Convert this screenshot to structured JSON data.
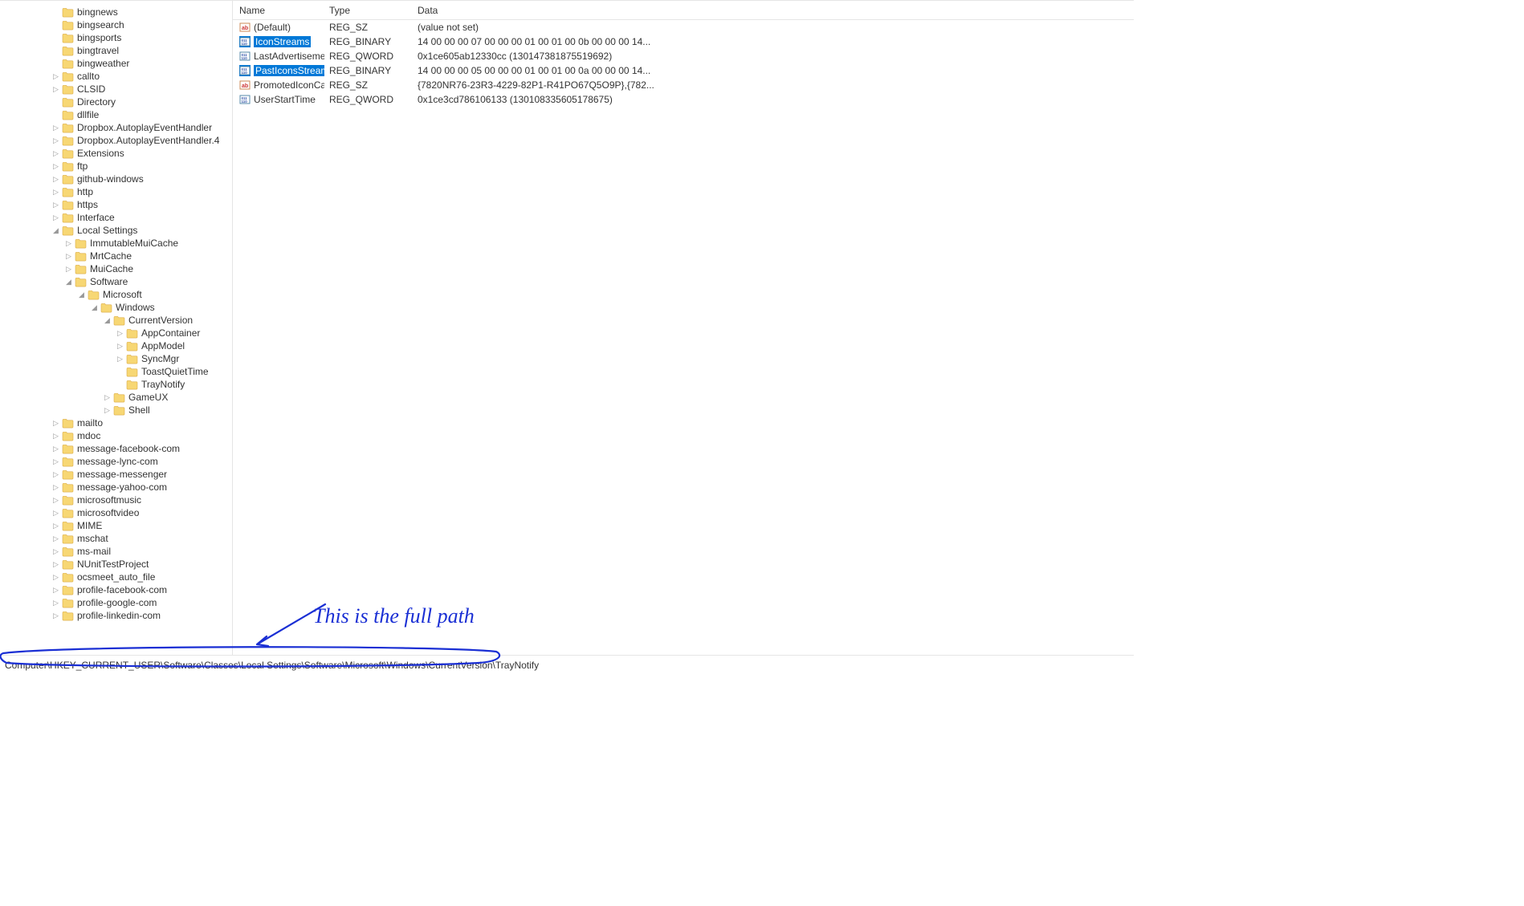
{
  "columns": {
    "name": "Name",
    "type": "Type",
    "data": "Data"
  },
  "rows": [
    {
      "icon": "sz",
      "name": "(Default)",
      "type": "REG_SZ",
      "data": "(value not set)",
      "selected": false
    },
    {
      "icon": "bin",
      "name": "IconStreams",
      "type": "REG_BINARY",
      "data": "14 00 00 00 07 00 00 00 01 00 01 00 0b 00 00 00 14...",
      "selected": true
    },
    {
      "icon": "bin",
      "name": "LastAdvertisement",
      "type": "REG_QWORD",
      "data": "0x1ce605ab12330cc (130147381875519692)",
      "selected": false
    },
    {
      "icon": "bin",
      "name": "PastIconsStream",
      "type": "REG_BINARY",
      "data": "14 00 00 00 05 00 00 00 01 00 01 00 0a 00 00 00 14...",
      "selected": true
    },
    {
      "icon": "sz",
      "name": "PromotedIconCa...",
      "type": "REG_SZ",
      "data": "{7820NR76-23R3-4229-82P1-R41PO67Q5O9P},{782...",
      "selected": false
    },
    {
      "icon": "bin",
      "name": "UserStartTime",
      "type": "REG_QWORD",
      "data": "0x1ce3cd786106133 (130108335605178675)",
      "selected": false
    }
  ],
  "tree": [
    {
      "depth": 4,
      "exp": "",
      "label": "bingnews"
    },
    {
      "depth": 4,
      "exp": "",
      "label": "bingsearch"
    },
    {
      "depth": 4,
      "exp": "",
      "label": "bingsports"
    },
    {
      "depth": 4,
      "exp": "",
      "label": "bingtravel"
    },
    {
      "depth": 4,
      "exp": "",
      "label": "bingweather"
    },
    {
      "depth": 4,
      "exp": "c",
      "label": "callto"
    },
    {
      "depth": 4,
      "exp": "c",
      "label": "CLSID"
    },
    {
      "depth": 4,
      "exp": "",
      "label": "Directory"
    },
    {
      "depth": 4,
      "exp": "",
      "label": "dllfile"
    },
    {
      "depth": 4,
      "exp": "c",
      "label": "Dropbox.AutoplayEventHandler"
    },
    {
      "depth": 4,
      "exp": "c",
      "label": "Dropbox.AutoplayEventHandler.4"
    },
    {
      "depth": 4,
      "exp": "c",
      "label": "Extensions"
    },
    {
      "depth": 4,
      "exp": "c",
      "label": "ftp"
    },
    {
      "depth": 4,
      "exp": "c",
      "label": "github-windows"
    },
    {
      "depth": 4,
      "exp": "c",
      "label": "http"
    },
    {
      "depth": 4,
      "exp": "c",
      "label": "https"
    },
    {
      "depth": 4,
      "exp": "c",
      "label": "Interface"
    },
    {
      "depth": 4,
      "exp": "o",
      "label": "Local Settings"
    },
    {
      "depth": 5,
      "exp": "c",
      "label": "ImmutableMuiCache"
    },
    {
      "depth": 5,
      "exp": "c",
      "label": "MrtCache"
    },
    {
      "depth": 5,
      "exp": "c",
      "label": "MuiCache"
    },
    {
      "depth": 5,
      "exp": "o",
      "label": "Software"
    },
    {
      "depth": 6,
      "exp": "o",
      "label": "Microsoft"
    },
    {
      "depth": 7,
      "exp": "o",
      "label": "Windows"
    },
    {
      "depth": 8,
      "exp": "o",
      "label": "CurrentVersion"
    },
    {
      "depth": 9,
      "exp": "c",
      "label": "AppContainer"
    },
    {
      "depth": 9,
      "exp": "c",
      "label": "AppModel"
    },
    {
      "depth": 9,
      "exp": "c",
      "label": "SyncMgr"
    },
    {
      "depth": 9,
      "exp": "",
      "label": "ToastQuietTime"
    },
    {
      "depth": 9,
      "exp": "",
      "label": "TrayNotify"
    },
    {
      "depth": 8,
      "exp": "c",
      "label": "GameUX"
    },
    {
      "depth": 8,
      "exp": "c",
      "label": "Shell"
    },
    {
      "depth": 4,
      "exp": "c",
      "label": "mailto"
    },
    {
      "depth": 4,
      "exp": "c",
      "label": "mdoc"
    },
    {
      "depth": 4,
      "exp": "c",
      "label": "message-facebook-com"
    },
    {
      "depth": 4,
      "exp": "c",
      "label": "message-lync-com"
    },
    {
      "depth": 4,
      "exp": "c",
      "label": "message-messenger"
    },
    {
      "depth": 4,
      "exp": "c",
      "label": "message-yahoo-com"
    },
    {
      "depth": 4,
      "exp": "c",
      "label": "microsoftmusic"
    },
    {
      "depth": 4,
      "exp": "c",
      "label": "microsoftvideo"
    },
    {
      "depth": 4,
      "exp": "c",
      "label": "MIME"
    },
    {
      "depth": 4,
      "exp": "c",
      "label": "mschat"
    },
    {
      "depth": 4,
      "exp": "c",
      "label": "ms-mail"
    },
    {
      "depth": 4,
      "exp": "c",
      "label": "NUnitTestProject"
    },
    {
      "depth": 4,
      "exp": "c",
      "label": "ocsmeet_auto_file"
    },
    {
      "depth": 4,
      "exp": "c",
      "label": "profile-facebook-com"
    },
    {
      "depth": 4,
      "exp": "c",
      "label": "profile-google-com"
    },
    {
      "depth": 4,
      "exp": "c",
      "label": "profile-linkedin-com"
    }
  ],
  "statusbar": "Computer\\HKEY_CURRENT_USER\\Software\\Classes\\Local Settings\\Software\\Microsoft\\Windows\\CurrentVersion\\TrayNotify",
  "annotation": "This  is the full path"
}
